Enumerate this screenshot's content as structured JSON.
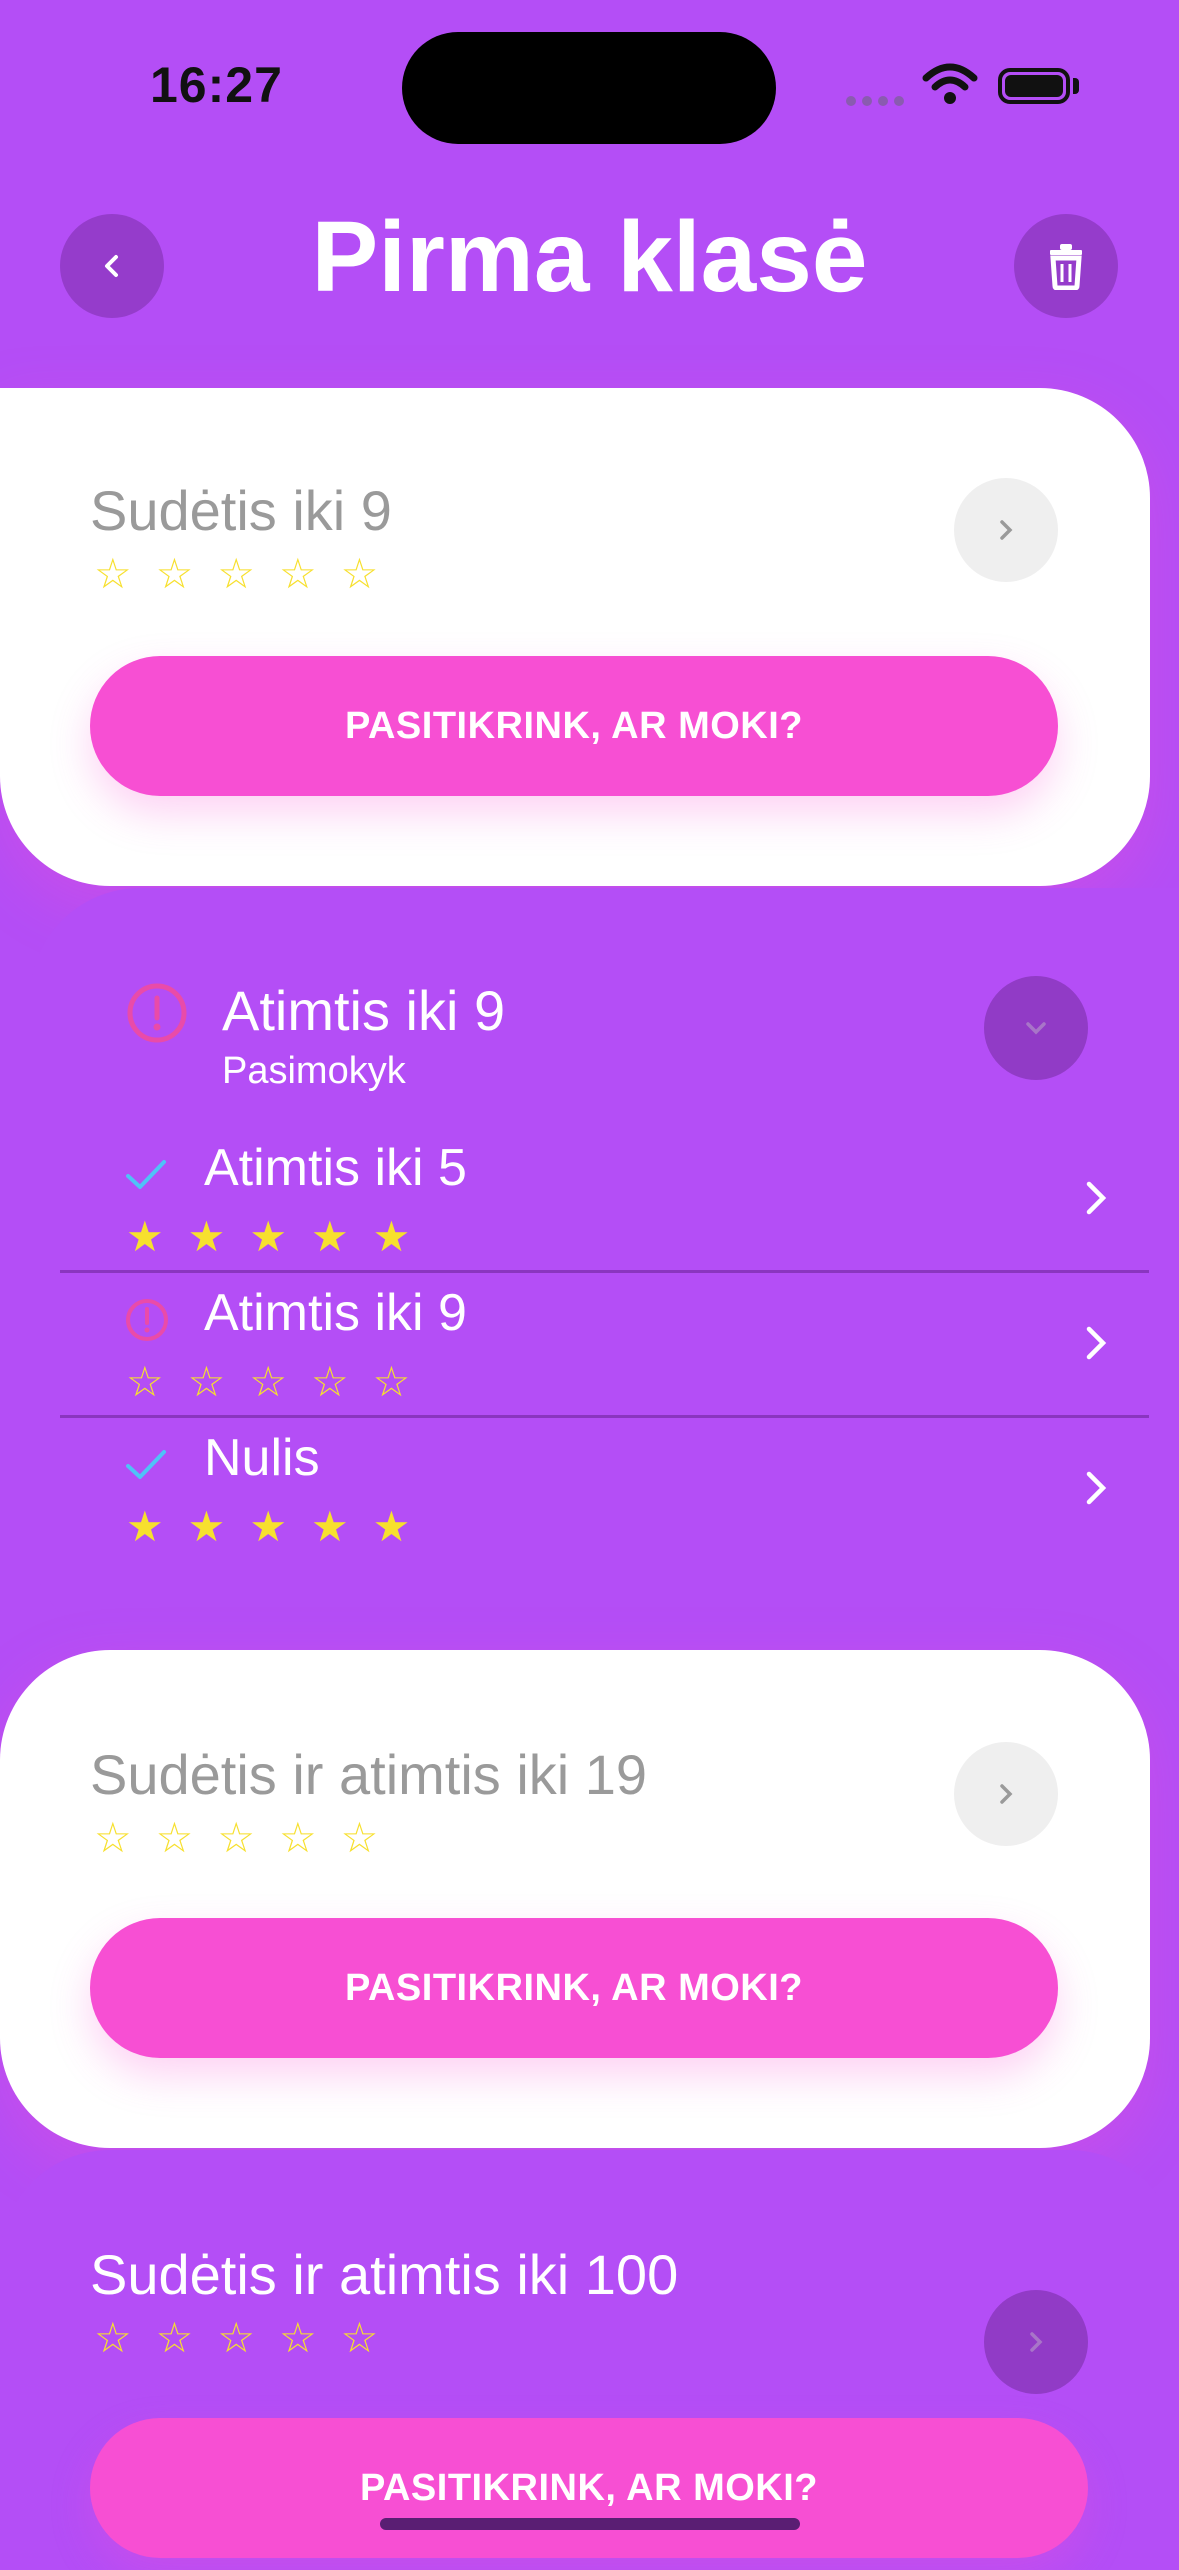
{
  "status_bar": {
    "time": "16:27"
  },
  "header": {
    "title": "Pirma klasė",
    "back_icon": "chevron-left-icon",
    "delete_icon": "trash-icon"
  },
  "colors": {
    "background": "#b44ef6",
    "accent_pink": "#f74fd3",
    "star": "#f7e02e",
    "check": "#4fc3f7",
    "warning": "#e94ba9"
  },
  "lessons": [
    {
      "title": "Sudėtis iki 9",
      "stars_filled": 0,
      "stars_total": 5,
      "button": "PASITIKRINK, AR MOKI?"
    },
    {
      "title": "Atimtis iki 9",
      "subtitle": "Pasimokyk",
      "expanded": true,
      "sublessons": [
        {
          "title": "Atimtis iki 5",
          "status": "done",
          "stars_filled": 5
        },
        {
          "title": "Atimtis iki 9",
          "status": "warning",
          "stars_filled": 0
        },
        {
          "title": "Nulis",
          "status": "done",
          "stars_filled": 5
        }
      ]
    },
    {
      "title": "Sudėtis ir atimtis iki 19",
      "stars_filled": 0,
      "stars_total": 5,
      "button": "PASITIKRINK, AR MOKI?"
    },
    {
      "title": "Sudėtis ir atimtis iki 100",
      "stars_filled": 0,
      "stars_total": 5,
      "button": "PASITIKRINK, AR MOKI?"
    }
  ]
}
